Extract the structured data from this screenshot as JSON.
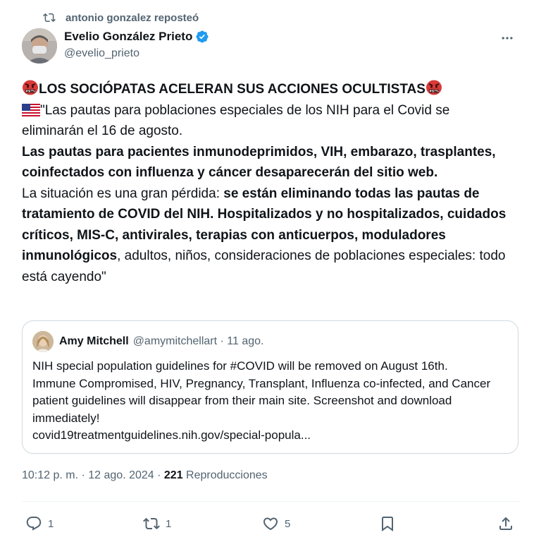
{
  "repost": {
    "text": "antonio gonzalez reposteó"
  },
  "author": {
    "name": "Evelio González Prieto",
    "handle": "@evelio_prieto"
  },
  "tweet": {
    "headline": "LOS SOCIÓPATAS ACELERAN SUS ACCIONES OCULTISTAS",
    "line1": "\"Las pautas para poblaciones especiales de los NIH para el Covid se eliminarán el 16 de agosto.",
    "line2": "Las pautas para pacientes inmunodeprimidos, VIH, embarazo, trasplantes, coinfectados con influenza y cáncer desaparecerán del sitio web.",
    "line3_normal": "La situación es una gran pérdida: ",
    "line3_bold": "se están eliminando todas las pautas de tratamiento de COVID del NIH. Hospitalizados y no hospitalizados, cuidados críticos, MIS-C, antivirales, terapias con anticuerpos, moduladores inmunológicos",
    "line3_tail": ", adultos, niños, consideraciones de poblaciones especiales: todo está cayendo\""
  },
  "quote": {
    "name": "Amy Mitchell",
    "meta": "@amymitchellart · 11 ago.",
    "line1": "NIH special population guidelines for #COVID will be removed on August 16th.",
    "line2": "Immune Compromised, HIV, Pregnancy, Transplant, Influenza co-infected, and Cancer patient guidelines will disappear from their main site. Screenshot and download immediately!",
    "link": "covid19treatmentguidelines.nih.gov/special-popula..."
  },
  "meta": {
    "timestamp": "10:12 p. m. · 12 ago. 2024 · ",
    "views_count": "221",
    "views_label": " Reproducciones"
  },
  "actions": {
    "replies": "1",
    "reposts": "1",
    "likes": "5"
  },
  "icons": [
    "repost-icon",
    "verified-badge-icon",
    "more-icon",
    "angry-face-icon",
    "us-flag-icon",
    "reply-icon",
    "like-icon",
    "bookmark-icon",
    "share-icon"
  ],
  "colors": {
    "verified": "#1d9bf0",
    "secondary_text": "#536471",
    "border": "#cfd9de"
  }
}
